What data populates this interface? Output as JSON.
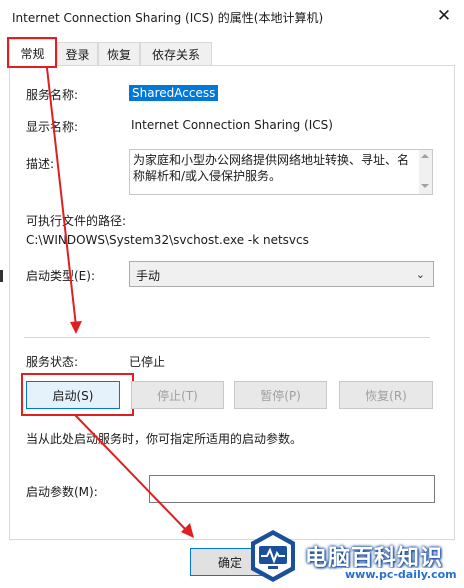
{
  "window": {
    "title": "Internet Connection Sharing (ICS) 的属性(本地计算机)",
    "close_glyph": "✕"
  },
  "tabs": [
    {
      "label": "常规",
      "selected": true
    },
    {
      "label": "登录",
      "selected": false
    },
    {
      "label": "恢复",
      "selected": false
    },
    {
      "label": "依存关系",
      "selected": false
    }
  ],
  "general": {
    "service_name_label": "服务名称:",
    "service_name": "SharedAccess",
    "display_name_label": "显示名称:",
    "display_name": "Internet Connection Sharing (ICS)",
    "description_label": "描述:",
    "description": "为家庭和小型办公网络提供网络地址转换、寻址、名称解析和/或入侵保护服务。",
    "exe_path_label": "可执行文件的路径:",
    "exe_path": "C:\\WINDOWS\\System32\\svchost.exe -k netsvcs",
    "startup_type_label": "启动类型(E):",
    "startup_type": "手动",
    "status_label": "服务状态:",
    "status_value": "已停止",
    "hint": "当从此处启动服务时，你可指定所适用的启动参数。",
    "params_label": "启动参数(M):",
    "params_value": ""
  },
  "buttons": {
    "start": "启动(S)",
    "stop": "停止(T)",
    "pause": "暂停(P)",
    "resume": "恢复(R)",
    "ok": "确定"
  },
  "watermark": {
    "brand": "电脑百科知识",
    "url": "www.pc-daily.com"
  },
  "colors": {
    "annotation_red": "#e02020",
    "selection_blue": "#0078d7",
    "watermark_blue": "#1a4f9c"
  }
}
